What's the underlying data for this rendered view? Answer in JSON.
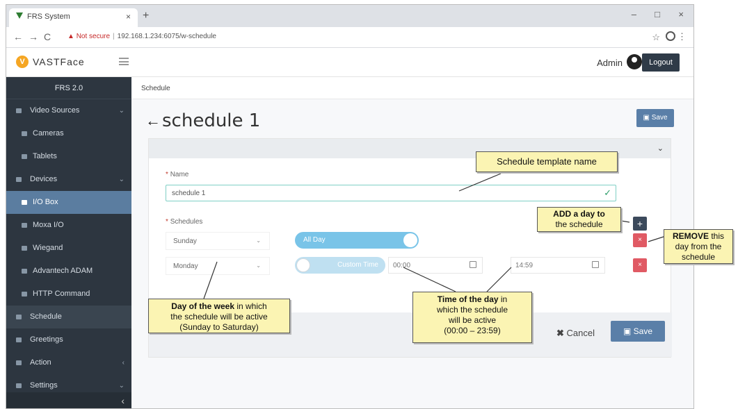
{
  "browser": {
    "tab_title": "FRS System",
    "tab_close": "×",
    "new_tab": "+",
    "window_controls": [
      "–",
      "□",
      "×"
    ],
    "nav": [
      "←",
      "→",
      "C"
    ],
    "not_secure": "Not secure",
    "url": "192.168.1.234:6075/w-schedule",
    "star": "☆",
    "menu": "⋮"
  },
  "header": {
    "logo_badge": "V",
    "logo_text": "VASTFace",
    "admin": "Admin",
    "logout": "Logout"
  },
  "sidebar": {
    "title": "FRS 2.0",
    "items": [
      {
        "label": "Video Sources",
        "chevron": "⌄",
        "sub": false,
        "icon": "video-icon"
      },
      {
        "label": "Cameras",
        "sub": true,
        "icon": "camera-icon"
      },
      {
        "label": "Tablets",
        "sub": true,
        "icon": "tablet-icon"
      },
      {
        "label": "Devices",
        "chevron": "⌄",
        "sub": false,
        "icon": "device-icon"
      },
      {
        "label": "I/O Box",
        "sub": true,
        "active": true,
        "icon": "io-box-icon"
      },
      {
        "label": "Moxa I/O",
        "sub": true,
        "icon": "moxa-icon"
      },
      {
        "label": "Wiegand",
        "sub": true,
        "icon": "wiegand-icon"
      },
      {
        "label": "Advantech ADAM",
        "sub": true,
        "icon": "adam-icon"
      },
      {
        "label": "HTTP Command",
        "sub": true,
        "icon": "http-icon"
      },
      {
        "label": "Schedule",
        "sub": false,
        "highlight": true,
        "icon": "schedule-icon"
      },
      {
        "label": "Greetings",
        "sub": false,
        "icon": "greetings-icon"
      },
      {
        "label": "Action",
        "chevron": "‹",
        "sub": false,
        "icon": "action-icon"
      },
      {
        "label": "Settings",
        "chevron": "⌄",
        "sub": false,
        "icon": "settings-icon"
      }
    ],
    "collapse": "‹"
  },
  "breadcrumb": "Schedule",
  "page": {
    "back": "←",
    "title": "schedule 1",
    "save_top": "Save",
    "name_label": "Name",
    "name_value": "schedule 1",
    "name_ok": "✓",
    "schedules_label": "Schedules",
    "required_mark": "*",
    "rows": [
      {
        "day": "Sunday",
        "toggle_label": "All Day"
      },
      {
        "day": "Monday",
        "toggle_label": "Custom Time",
        "start": "00:00",
        "end": "14:59"
      }
    ],
    "caret": "⌄",
    "add": "+",
    "remove": "×",
    "panel_chevron": "⌄",
    "cancel": "Cancel",
    "cancel_x": "✖",
    "save_bottom": "Save"
  },
  "annotations": {
    "template_name": "Schedule template name",
    "add_day": [
      "ADD a day to",
      "the schedule"
    ],
    "remove_day": {
      "bold": "REMOVE",
      "rest1": " this",
      "line2": "day from the",
      "line3": "schedule"
    },
    "day_of_week": {
      "bold": "Day of  the week",
      "rest1": " in which",
      "line2": "the schedule will be active",
      "line3": "(Sunday to Saturday)"
    },
    "time_of_day": {
      "bold": "Time of  the day",
      "rest1": " in",
      "line2": "which the schedule",
      "line3": "will be active",
      "line4": "(00:00 – 23:59)"
    }
  },
  "colors": {
    "sidebar_bg": "#2d3640",
    "sidebar_active": "#5b7da0",
    "primary": "#5a7fa8",
    "danger": "#e05a64",
    "toggle": "#79c4e8",
    "callout": "#fbf4b3"
  }
}
